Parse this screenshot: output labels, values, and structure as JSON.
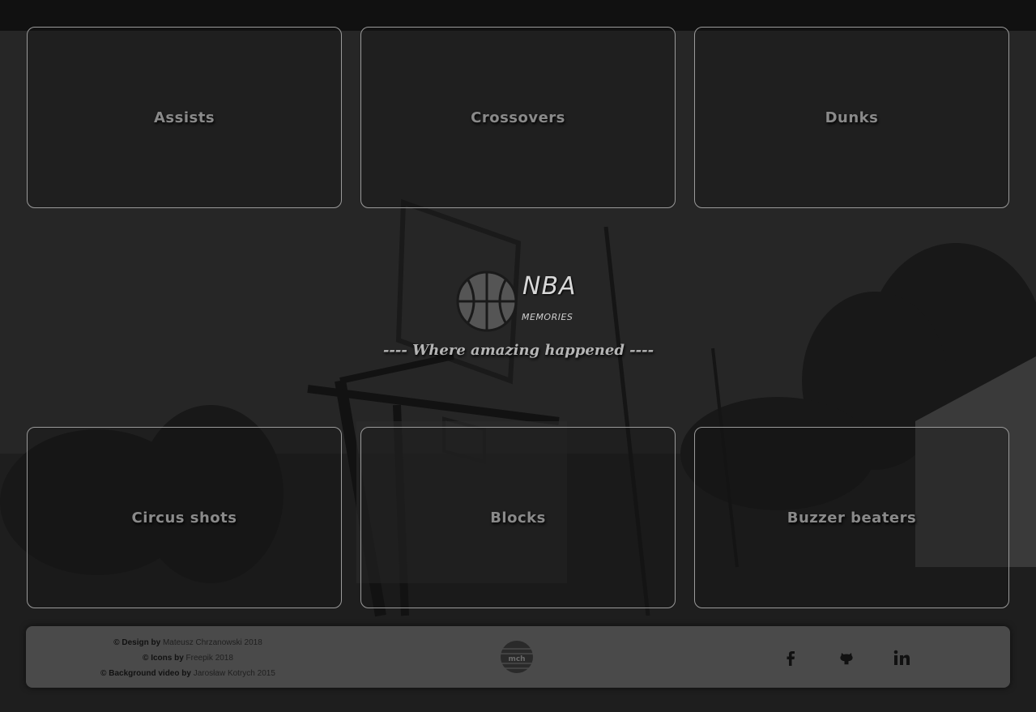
{
  "tiles_top": [
    {
      "label": "Assists"
    },
    {
      "label": "Crossovers"
    },
    {
      "label": "Dunks"
    }
  ],
  "tiles_bottom": [
    {
      "label": "Circus shots"
    },
    {
      "label": "Blocks"
    },
    {
      "label": "Buzzer beaters"
    }
  ],
  "logo": {
    "title": "NBA",
    "subtitle": "MEMORIES",
    "icon": "basketball-icon"
  },
  "tagline": "---- Where amazing happened ----",
  "footer": {
    "credits": [
      {
        "prefix": "© Design by",
        "name": "Mateusz Chrzanowski",
        "year": "2018"
      },
      {
        "prefix": "© Icons by",
        "name": "Freepik",
        "year": "2018"
      },
      {
        "prefix": "© Background video by",
        "name": "Jarosław Kotrych",
        "year": "2015"
      }
    ],
    "brand_mark": "mch",
    "social": [
      {
        "icon": "facebook-icon"
      },
      {
        "icon": "github-icon"
      },
      {
        "icon": "linkedin-icon"
      }
    ]
  },
  "colors": {
    "page_bg": "#141414",
    "tile_border": "#9a9a9a",
    "tile_text": "#8a8a8a",
    "footer_bg": "#4a4a4a"
  }
}
